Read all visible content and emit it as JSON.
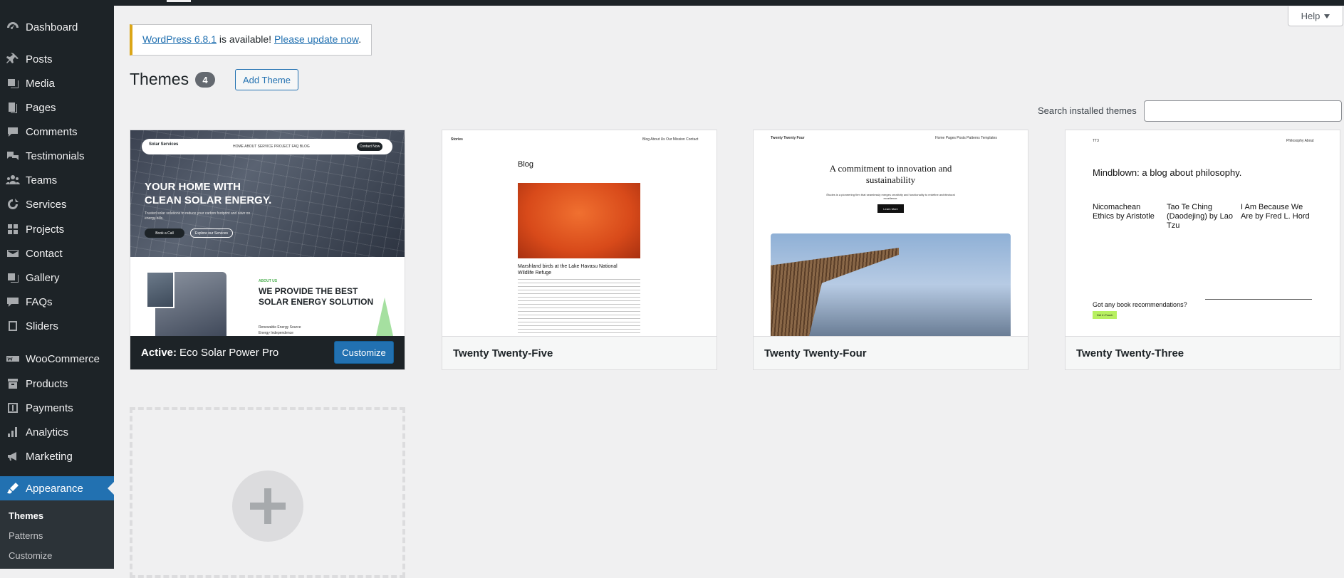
{
  "sidebar": {
    "items": [
      {
        "label": "Dashboard",
        "icon": "dashboard-icon"
      },
      {
        "label": "Posts",
        "icon": "pin-icon"
      },
      {
        "label": "Media",
        "icon": "media-icon"
      },
      {
        "label": "Pages",
        "icon": "pages-icon"
      },
      {
        "label": "Comments",
        "icon": "comment-icon"
      },
      {
        "label": "Testimonials",
        "icon": "testimonial-icon"
      },
      {
        "label": "Teams",
        "icon": "groups-icon"
      },
      {
        "label": "Services",
        "icon": "services-icon"
      },
      {
        "label": "Projects",
        "icon": "portfolio-icon"
      },
      {
        "label": "Contact",
        "icon": "email-icon"
      },
      {
        "label": "Gallery",
        "icon": "gallery-icon"
      },
      {
        "label": "FAQs",
        "icon": "faq-icon"
      },
      {
        "label": "Sliders",
        "icon": "slides-icon"
      },
      {
        "label": "WooCommerce",
        "icon": "woocommerce-icon"
      },
      {
        "label": "Products",
        "icon": "archive-icon"
      },
      {
        "label": "Payments",
        "icon": "payments-icon"
      },
      {
        "label": "Analytics",
        "icon": "chart-icon"
      },
      {
        "label": "Marketing",
        "icon": "megaphone-icon"
      },
      {
        "label": "Appearance",
        "icon": "brush-icon"
      }
    ],
    "submenu": [
      "Themes",
      "Patterns",
      "Customize"
    ]
  },
  "help": {
    "label": "Help"
  },
  "notice": {
    "version_link": "WordPress 6.8.1",
    "middle": " is available! ",
    "update_link": "Please update now",
    "end": "."
  },
  "header": {
    "title": "Themes",
    "count": "4",
    "add_label": "Add Theme"
  },
  "search": {
    "label": "Search installed themes",
    "value": ""
  },
  "themes": [
    {
      "active_label": "Active:",
      "name": "Eco Solar Power Pro",
      "customize_label": "Customize",
      "shot": {
        "logo": "Solar Services",
        "nav": "HOME  ABOUT  SERVICE  PROJECT  FAQ  BLOG",
        "cta": "Contact Now",
        "headline": "YOUR HOME WITH CLEAN SOLAR ENERGY.",
        "sub": "Trusted solar solutions to reduce your carbon footprint and save on energy bills.",
        "btn1": "Book a Call",
        "btn2": "Explore our Services",
        "tag": "ABOUT US",
        "h2": "WE PROVIDE THE BEST SOLAR ENERGY SOLUTION",
        "bullet1": "Renewable Energy Source",
        "bullet2": "Energy Independence"
      }
    },
    {
      "name": "Twenty Twenty-Five",
      "shot": {
        "site": "Stories",
        "nav": "Blog  About Us  Our Mission  Contact",
        "title": "Blog",
        "caption": "Marshland birds at the Lake Havasu National Wildlife Refuge"
      }
    },
    {
      "name": "Twenty Twenty-Four",
      "shot": {
        "site": "Twenty Twenty Four",
        "nav": "Home  Pages  Posts  Patterns  Templates",
        "headline": "A commitment to innovation and sustainability",
        "sub": "Études is a pioneering firm that seamlessly merges creativity and functionality to redefine architectural excellence.",
        "btn": "Learn More"
      }
    },
    {
      "name": "Twenty Twenty-Three",
      "shot": {
        "site": "TT3",
        "nav": "Philosophy  About",
        "headline": "Mindblown: a blog about philosophy.",
        "post1": "Nicomachean Ethics by Aristotle",
        "post2": "Tao Te Ching (Daodejing) by Lao Tzu",
        "post3": "I Am Because We Are by Fred L. Hord",
        "question": "Got any book recommendations?",
        "btn": "Get In Touch"
      }
    }
  ]
}
